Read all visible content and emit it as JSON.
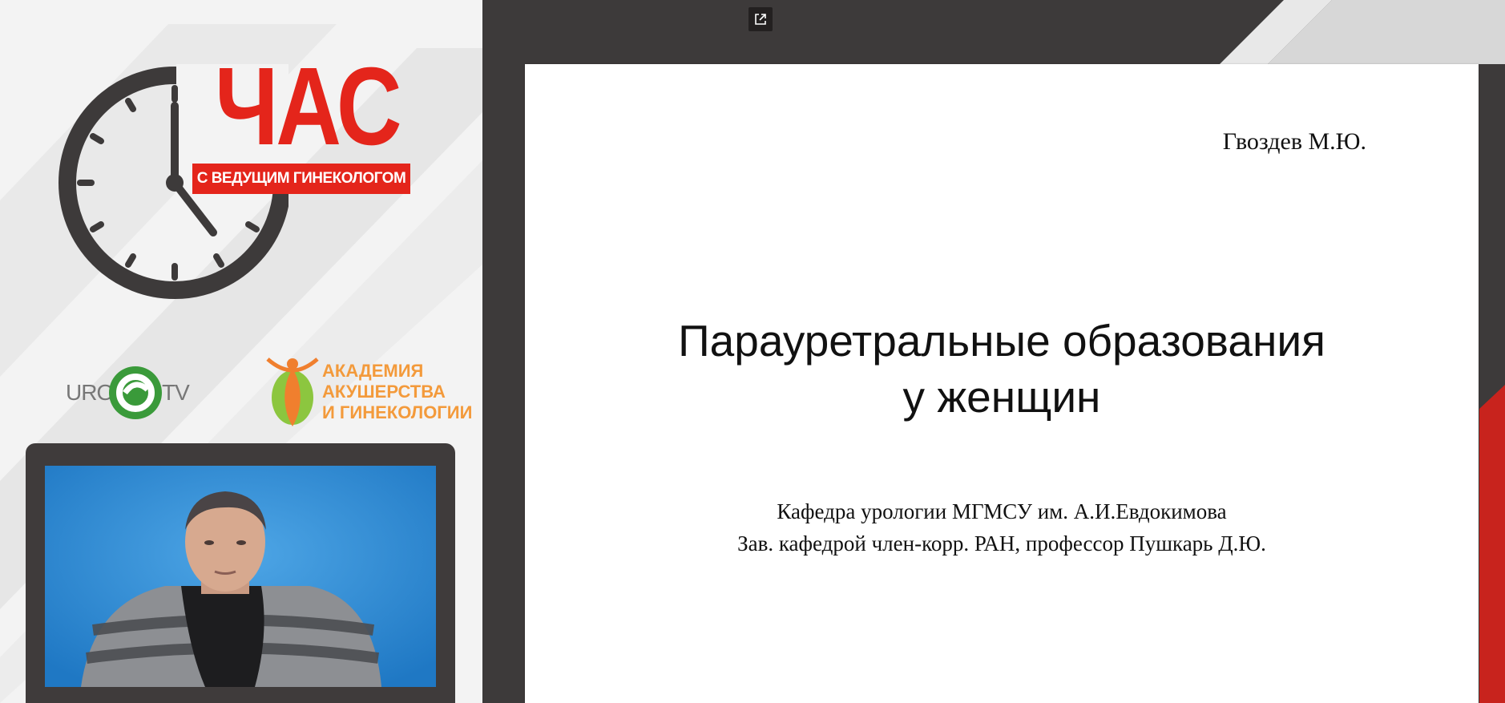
{
  "branding": {
    "show_title": "ЧАС",
    "show_subtitle": "С ВЕДУЩИМ ГИНЕКОЛОГОМ",
    "uro_tv": {
      "left": "URO",
      "right": "TV"
    },
    "academy": {
      "line1": "АКАДЕМИЯ",
      "line2": "АКУШЕРСТВА",
      "line3": "И ГИНЕКОЛОГИИ"
    }
  },
  "toolbar": {
    "open_external_icon": "open-external-icon"
  },
  "slide": {
    "author": "Гвоздев М.Ю.",
    "title_line1": "Парауретральные образования",
    "title_line2": "у женщин",
    "subtitle_line1": "Кафедра урологии МГМСУ им. А.И.Евдокимова",
    "subtitle_line2": "Зав. кафедрой член-корр. РАН, профессор Пушкарь Д.Ю."
  },
  "colors": {
    "brand_red": "#e4251b",
    "uro_green": "#3a9a3a",
    "academy_orange": "#f39a3b",
    "dark_frame": "#3d3a3a",
    "video_blue": "#2f8fd6"
  }
}
